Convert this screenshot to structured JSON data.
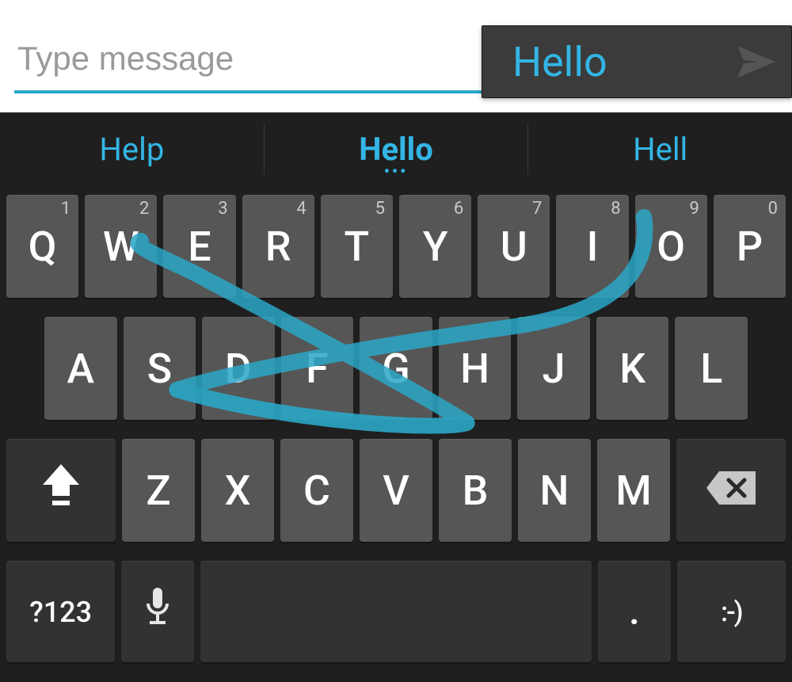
{
  "colors": {
    "accent": "#33b5e5",
    "underline": "#2aa7c7"
  },
  "input": {
    "placeholder": "Type message",
    "value": ""
  },
  "preview": {
    "text": "Hello"
  },
  "suggestions": [
    {
      "label": "Help"
    },
    {
      "label": "Hello",
      "primary": true
    },
    {
      "label": "Hell"
    }
  ],
  "keyboard": {
    "row1": [
      {
        "label": "Q",
        "alt": "1"
      },
      {
        "label": "W",
        "alt": "2"
      },
      {
        "label": "E",
        "alt": "3"
      },
      {
        "label": "R",
        "alt": "4"
      },
      {
        "label": "T",
        "alt": "5"
      },
      {
        "label": "Y",
        "alt": "6"
      },
      {
        "label": "U",
        "alt": "7"
      },
      {
        "label": "I",
        "alt": "8"
      },
      {
        "label": "O",
        "alt": "9"
      },
      {
        "label": "P",
        "alt": "0"
      }
    ],
    "row2": [
      {
        "label": "A"
      },
      {
        "label": "S"
      },
      {
        "label": "D"
      },
      {
        "label": "F"
      },
      {
        "label": "G"
      },
      {
        "label": "H"
      },
      {
        "label": "J"
      },
      {
        "label": "K"
      },
      {
        "label": "L"
      }
    ],
    "row3": [
      {
        "label": "Z"
      },
      {
        "label": "X"
      },
      {
        "label": "C"
      },
      {
        "label": "V"
      },
      {
        "label": "B"
      },
      {
        "label": "N"
      },
      {
        "label": "M"
      }
    ],
    "row4": {
      "symbols": "?123",
      "period": ".",
      "smiley": ":-)"
    }
  }
}
